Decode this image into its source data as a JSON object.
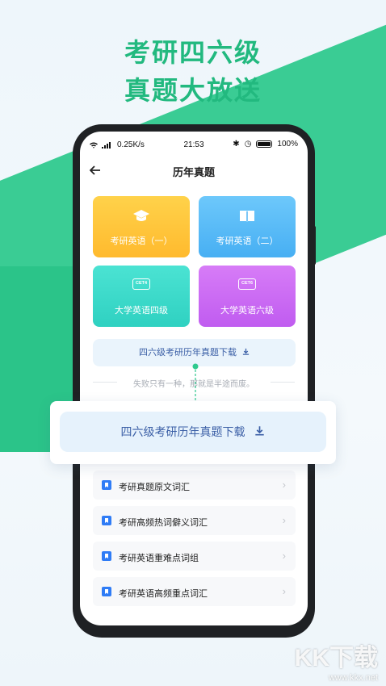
{
  "headline": {
    "line1": "考研四六级",
    "line2": "真题大放送"
  },
  "statusbar": {
    "network": "0.25K/s",
    "time": "21:53",
    "battery": "100%"
  },
  "nav": {
    "title": "历年真题"
  },
  "cards": [
    {
      "label": "考研英语（一）",
      "icon": "graduation-cap-icon"
    },
    {
      "label": "考研英语（二）",
      "icon": "book-icon"
    },
    {
      "label": "大学英语四级",
      "icon": "cet4-icon",
      "badge": "CET4"
    },
    {
      "label": "大学英语六级",
      "icon": "cet6-icon",
      "badge": "CET6"
    }
  ],
  "download": {
    "label": "四六级考研历年真题下载"
  },
  "overlay": {
    "label": "四六级考研历年真题下载"
  },
  "motto": "失败只有一种，那就是半途而废。",
  "list": [
    {
      "label": "考研真题原文词汇"
    },
    {
      "label": "考研高频热词僻义词汇"
    },
    {
      "label": "考研英语重难点词组"
    },
    {
      "label": "考研英语高频重点词汇"
    }
  ],
  "watermark": {
    "text": "KK下载",
    "url": "www.kkx.net"
  },
  "colors": {
    "accent": "#22b97f",
    "band": "#2fc98e",
    "link": "#3b5fa6"
  }
}
